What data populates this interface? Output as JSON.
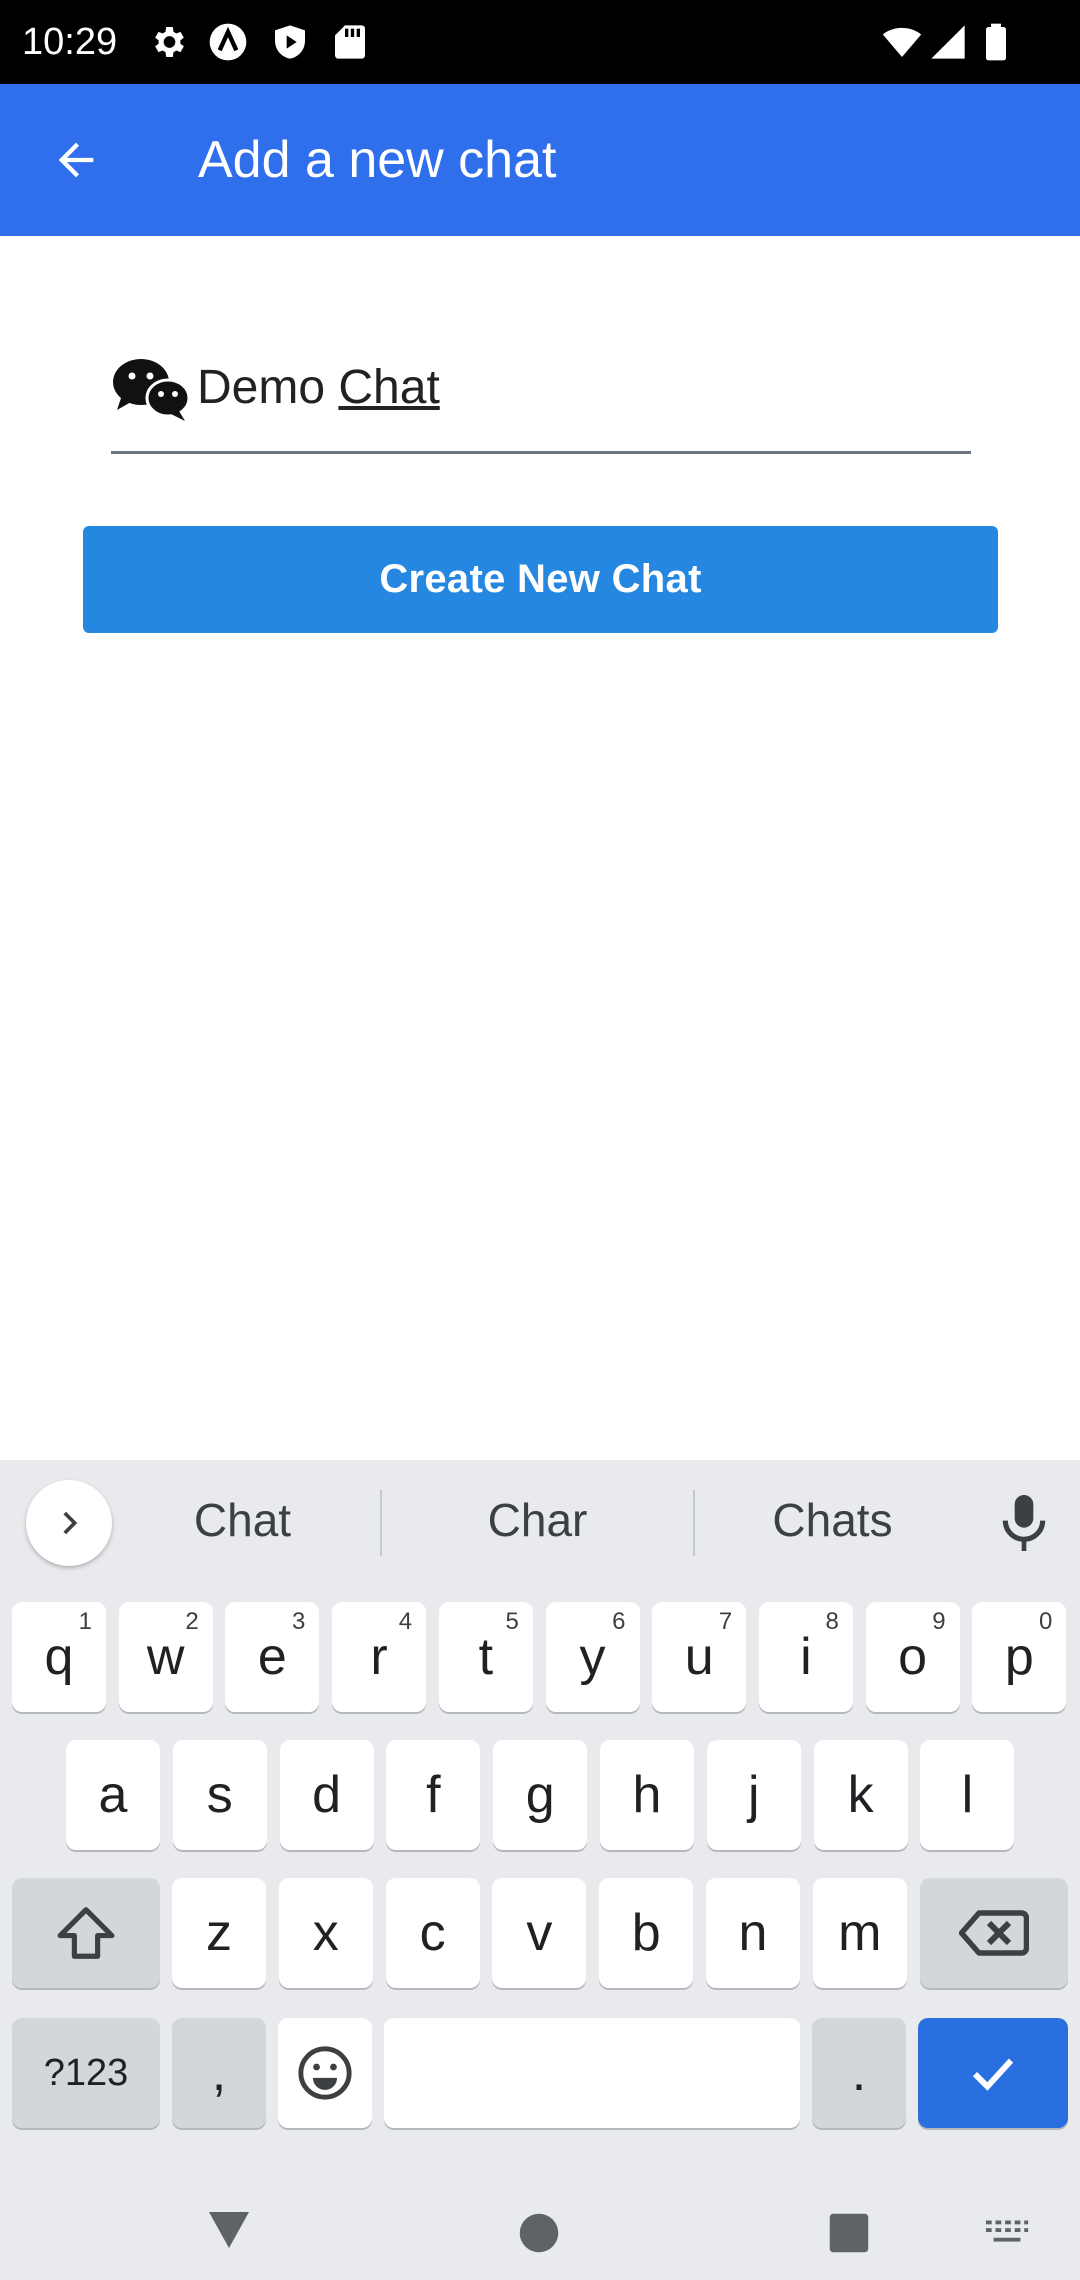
{
  "status_bar": {
    "time": "10:29",
    "icons": [
      "settings-icon",
      "a-icon",
      "shield-play-icon",
      "sd-card-icon",
      "wifi-icon",
      "signal-icon",
      "battery-icon"
    ]
  },
  "app_bar": {
    "title": "Add a new chat",
    "back_icon": "arrow-left-icon",
    "color": "#2f6fec"
  },
  "form": {
    "chat_name_word1": "Demo",
    "chat_name_word2": "Chat",
    "icon": "wechat-icon",
    "button_label": "Create New Chat",
    "button_color": "#2587e0"
  },
  "keyboard": {
    "suggestions": [
      "Chat",
      "Char",
      "Chats"
    ],
    "row1": [
      {
        "k": "q",
        "n": "1"
      },
      {
        "k": "w",
        "n": "2"
      },
      {
        "k": "e",
        "n": "3"
      },
      {
        "k": "r",
        "n": "4"
      },
      {
        "k": "t",
        "n": "5"
      },
      {
        "k": "y",
        "n": "6"
      },
      {
        "k": "u",
        "n": "7"
      },
      {
        "k": "i",
        "n": "8"
      },
      {
        "k": "o",
        "n": "9"
      },
      {
        "k": "p",
        "n": "0"
      }
    ],
    "row2": [
      "a",
      "s",
      "d",
      "f",
      "g",
      "h",
      "j",
      "k",
      "l"
    ],
    "row3": [
      "z",
      "x",
      "c",
      "v",
      "b",
      "n",
      "m"
    ],
    "symbols_label": "?123",
    "comma_label": ",",
    "period_label": ".",
    "action_color": "#2a6fe0"
  },
  "nav_bar": {
    "icons": [
      "back-triangle-icon",
      "home-circle-icon",
      "recents-square-icon",
      "keyboard-switch-icon"
    ]
  }
}
